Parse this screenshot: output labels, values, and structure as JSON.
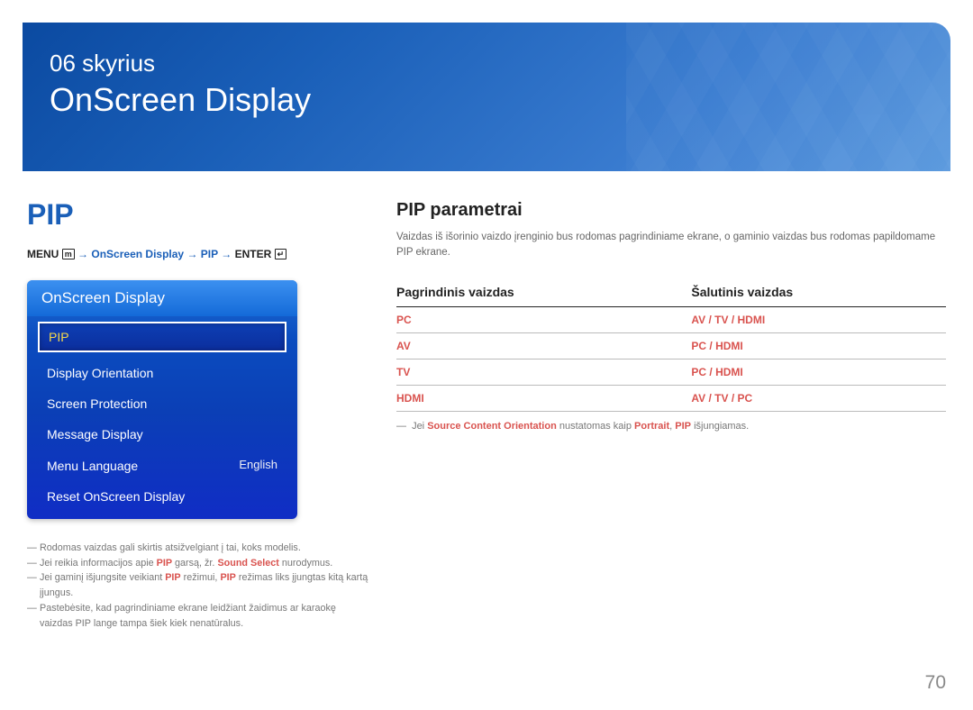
{
  "banner": {
    "chapter": "06 skyrius",
    "title": "OnScreen Display"
  },
  "left": {
    "heading": "PIP",
    "breadcrumb": {
      "prefix": "MENU",
      "icon1": "m",
      "arrow1": " → ",
      "seg1": "OnScreen Display",
      "arrow2": " → ",
      "seg2": "PIP",
      "arrow3": " → ",
      "suffix": "ENTER",
      "icon2": "↵"
    },
    "menu": {
      "header": "OnScreen Display",
      "selected": "PIP",
      "items": [
        {
          "label": "Display Orientation",
          "value": ""
        },
        {
          "label": "Screen Protection",
          "value": ""
        },
        {
          "label": "Message Display",
          "value": ""
        },
        {
          "label": "Menu Language",
          "value": "English"
        },
        {
          "label": "Reset OnScreen Display",
          "value": ""
        }
      ]
    },
    "footnotes": [
      {
        "pre": "Rodomas vaizdas gali skirtis atsižvelgiant į tai, koks modelis."
      },
      {
        "pre": "Jei reikia informacijos apie ",
        "red1": "PIP",
        "mid": " garsą, žr. ",
        "red2": "Sound Select",
        "post": " nurodymus."
      },
      {
        "pre": "Jei gaminį išjungsite veikiant ",
        "red1": "PIP",
        "mid": " režimui, ",
        "red2": "PIP",
        "post": " režimas liks įjungtas kitą kartą įjungus."
      },
      {
        "pre": "Pastebėsite, kad pagrindiniame ekrane leidžiant žaidimus ar karaokę vaizdas PIP lange tampa šiek kiek nenatūralus."
      }
    ]
  },
  "right": {
    "heading": "PIP parametrai",
    "desc": "Vaizdas iš išorinio vaizdo įrenginio bus rodomas pagrindiniame ekrane, o gaminio vaizdas bus rodomas papildomame PIP ekrane.",
    "table": {
      "col1": "Pagrindinis vaizdas",
      "col2": "Šalutinis vaizdas",
      "rows": [
        {
          "main": "PC",
          "sub": "AV / TV / HDMI"
        },
        {
          "main": "AV",
          "sub": "PC / HDMI"
        },
        {
          "main": "TV",
          "sub": "PC / HDMI"
        },
        {
          "main": "HDMI",
          "sub": "AV / TV / PC"
        }
      ]
    },
    "src_note": {
      "pre": "Jei ",
      "red1": "Source Content Orientation",
      "mid": " nustatomas kaip ",
      "red2": "Portrait",
      "mid2": ", ",
      "red3": "PIP",
      "post": " išjungiamas."
    }
  },
  "page_number": "70"
}
